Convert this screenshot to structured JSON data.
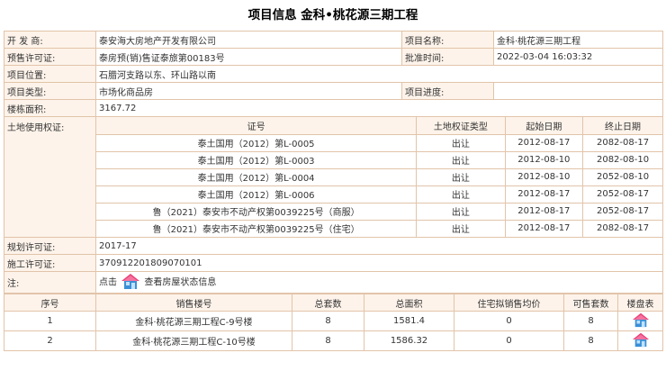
{
  "title": "项目信息 金科•桃花源三期工程",
  "info": {
    "developer_label": "开 发 商:",
    "developer": "泰安海大房地产开发有限公司",
    "project_name_label": "项目名称:",
    "project_name": "金科·桃花源三期工程",
    "presale_label": "预售许可证:",
    "presale": "泰房预(销)售证泰旅第00183号",
    "approval_label": "批准时间:",
    "approval": "2022-03-04 16:03:32",
    "location_label": "项目位置:",
    "location": "石腊河支路以东、环山路以南",
    "type_label": "项目类型:",
    "type": "市场化商品房",
    "progress_label": "项目进度:",
    "progress": "",
    "area_label": "楼栋面积:",
    "area": "3167.72",
    "land_label": "土地使用权证:",
    "planning_label": "规划许可证:",
    "planning": "2017-17",
    "construction_label": "施工许可证:",
    "construction": "370912201809070101",
    "note_label": "注:",
    "note_prefix": "点击",
    "note_suffix": "查看房屋状态信息"
  },
  "land_table": {
    "headers": [
      "证号",
      "土地权证类型",
      "起始日期",
      "终止日期"
    ],
    "rows": [
      [
        "泰土国用（2012）第L-0005",
        "出让",
        "2012-08-17",
        "2082-08-17"
      ],
      [
        "泰土国用（2012）第L-0003",
        "出让",
        "2012-08-10",
        "2082-08-10"
      ],
      [
        "泰土国用（2012）第L-0004",
        "出让",
        "2012-08-10",
        "2052-08-10"
      ],
      [
        "泰土国用（2012）第L-0006",
        "出让",
        "2012-08-17",
        "2052-08-17"
      ],
      [
        "鲁（2021）泰安市不动产权第0039225号（商服）",
        "出让",
        "2012-08-17",
        "2052-08-17"
      ],
      [
        "鲁（2021）泰安市不动产权第0039225号（住宅）",
        "出让",
        "2012-08-17",
        "2082-08-17"
      ]
    ]
  },
  "sales_table": {
    "headers": [
      "序号",
      "销售楼号",
      "总套数",
      "总面积",
      "住宅拟销售均价",
      "可售套数",
      "楼盘表"
    ],
    "rows": [
      [
        "1",
        "金科·桃花源三期工程C-9号楼",
        "8",
        "1581.4",
        "0",
        "8"
      ],
      [
        "2",
        "金科·桃花源三期工程C-10号楼",
        "8",
        "1586.32",
        "0",
        "8"
      ]
    ]
  },
  "icons": {
    "house": "house-icon"
  },
  "colors": {
    "label_bg": "#fdf3ea",
    "border": "#e2c4aa",
    "roof": "#e8417a",
    "wall": "#3b8fd6"
  }
}
